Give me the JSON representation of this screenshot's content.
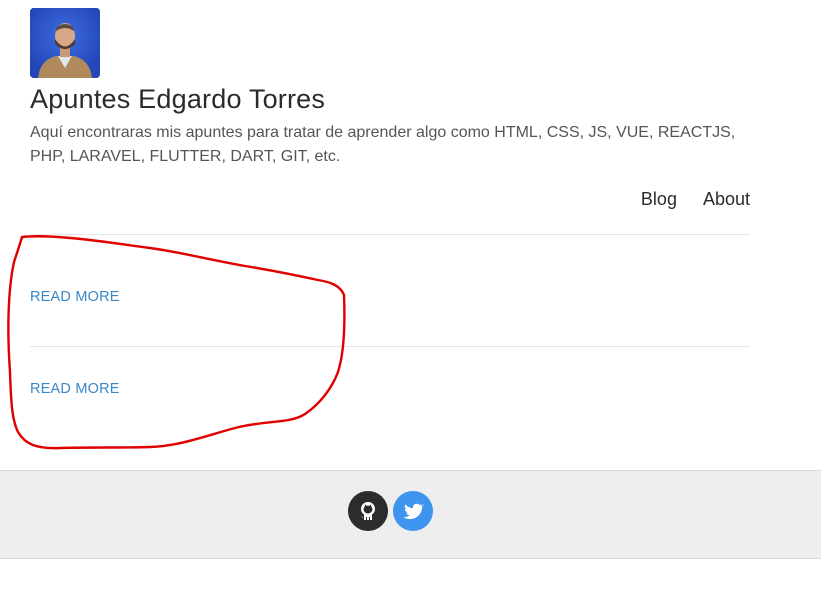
{
  "header": {
    "avatar_alt": "Edgardo Torres",
    "title": "Apuntes Edgardo Torres",
    "description": "Aquí encontraras mis apuntes para tratar de aprender algo como HTML, CSS, JS, VUE, REACTJS, PHP, LARAVEL, FLUTTER, DART, GIT, etc."
  },
  "nav": {
    "items": [
      {
        "label": "Blog"
      },
      {
        "label": "About"
      }
    ]
  },
  "posts": [
    {
      "read_more": "READ MORE"
    },
    {
      "read_more": "READ MORE"
    }
  ],
  "footer": {
    "social": [
      {
        "icon": "github-icon",
        "color": "#2c2c2c"
      },
      {
        "icon": "twitter-icon",
        "color": "#3f94f0"
      }
    ]
  },
  "annotation": {
    "color": "#e00000",
    "shape": "hand-drawn loop around the READ MORE links"
  }
}
